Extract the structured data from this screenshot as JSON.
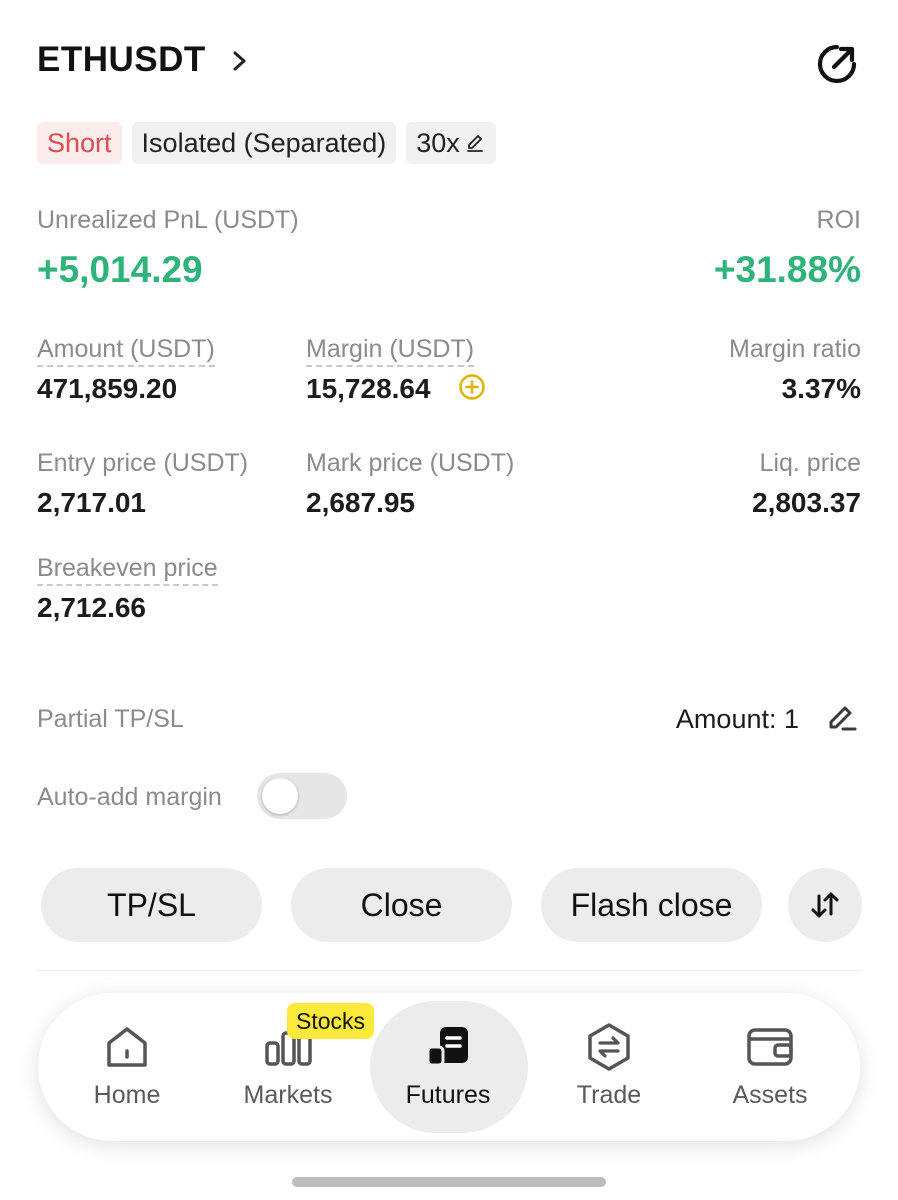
{
  "header": {
    "pair": "ETHUSDT"
  },
  "tags": {
    "side": "Short",
    "margin_mode": "Isolated (Separated)",
    "leverage": "30x"
  },
  "pnl": {
    "label": "Unrealized PnL (USDT)",
    "value": "+5,014.29",
    "roi_label": "ROI",
    "roi_value": "+31.88%"
  },
  "stats": {
    "amount_label": "Amount (USDT)",
    "amount_value": "471,859.20",
    "margin_label": "Margin (USDT)",
    "margin_value": "15,728.64",
    "ratio_label": "Margin ratio",
    "ratio_value": "3.37%",
    "entry_label": "Entry price (USDT)",
    "entry_value": "2,717.01",
    "mark_label": "Mark price (USDT)",
    "mark_value": "2,687.95",
    "liq_label": "Liq. price",
    "liq_value": "2,803.37",
    "breakeven_label": "Breakeven price",
    "breakeven_value": "2,712.66"
  },
  "partial": {
    "label": "Partial TP/SL",
    "amount": "Amount: 1"
  },
  "auto_margin": {
    "label": "Auto-add margin",
    "enabled": false
  },
  "actions": {
    "tpsl": "TP/SL",
    "close": "Close",
    "flash_close": "Flash close"
  },
  "tabbar": {
    "badge": "Stocks",
    "items": [
      {
        "label": "Home",
        "icon": "home-icon"
      },
      {
        "label": "Markets",
        "icon": "markets-icon"
      },
      {
        "label": "Futures",
        "icon": "futures-icon",
        "active": true
      },
      {
        "label": "Trade",
        "icon": "trade-icon"
      },
      {
        "label": "Assets",
        "icon": "wallet-icon"
      }
    ]
  },
  "colors": {
    "green": "#2fb37a",
    "red": "#e04b4b",
    "badge": "#fce93c",
    "coin": "#e2b200"
  }
}
